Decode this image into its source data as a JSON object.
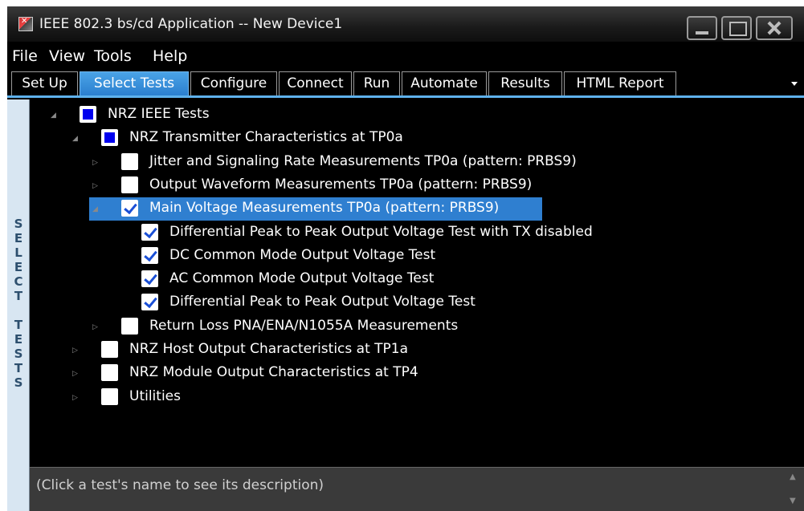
{
  "window": {
    "title": "IEEE 802.3 bs/cd Application -- New Device1",
    "icon": "app-icon"
  },
  "menu": [
    "File",
    "View",
    "Tools",
    "Help"
  ],
  "tabs": [
    {
      "label": "Set Up",
      "active": false
    },
    {
      "label": "Select Tests",
      "active": true
    },
    {
      "label": "Configure",
      "active": false
    },
    {
      "label": "Connect",
      "active": false
    },
    {
      "label": "Run",
      "active": false
    },
    {
      "label": "Automate",
      "active": false
    },
    {
      "label": "Results",
      "active": false
    },
    {
      "label": "HTML Report",
      "active": false
    }
  ],
  "side_label": "SELECT TESTS",
  "tree": [
    {
      "label": "NRZ IEEE Tests",
      "level": 0,
      "state": "partial",
      "expander": "expanded"
    },
    {
      "label": "NRZ Transmitter Characteristics at TP0a",
      "level": 1,
      "state": "partial",
      "expander": "expanded"
    },
    {
      "label": "Jitter and Signaling Rate Measurements TP0a (pattern: PRBS9)",
      "level": 2,
      "state": "unchecked",
      "expander": "collapsed"
    },
    {
      "label": "Output Waveform Measurements TP0a (pattern: PRBS9)",
      "level": 2,
      "state": "unchecked",
      "expander": "collapsed"
    },
    {
      "label": "Main Voltage Measurements TP0a (pattern: PRBS9)",
      "level": 2,
      "state": "checked",
      "expander": "expanded",
      "selected": true
    },
    {
      "label": "Differential Peak to Peak Output Voltage Test with TX disabled",
      "level": 3,
      "state": "checked",
      "expander": "none"
    },
    {
      "label": "DC Common Mode Output Voltage Test",
      "level": 3,
      "state": "checked",
      "expander": "none"
    },
    {
      "label": "AC Common Mode Output Voltage Test",
      "level": 3,
      "state": "checked",
      "expander": "none"
    },
    {
      "label": "Differential Peak to Peak Output Voltage Test",
      "level": 3,
      "state": "checked",
      "expander": "none"
    },
    {
      "label": "Return Loss PNA/ENA/N1055A Measurements",
      "level": 2,
      "state": "unchecked",
      "expander": "collapsed"
    },
    {
      "label": "NRZ Host Output Characteristics at TP1a",
      "level": 1,
      "state": "unchecked",
      "expander": "collapsed"
    },
    {
      "label": "NRZ Module Output Characteristics at TP4",
      "level": 1,
      "state": "unchecked",
      "expander": "collapsed"
    },
    {
      "label": "Utilities",
      "level": 1,
      "state": "unchecked",
      "expander": "collapsed"
    }
  ],
  "description": {
    "text": "(Click a test's name to see its description)"
  },
  "colors": {
    "accent": "#2f7fd0",
    "active_tab": "#3a93dc",
    "background": "#000000"
  }
}
